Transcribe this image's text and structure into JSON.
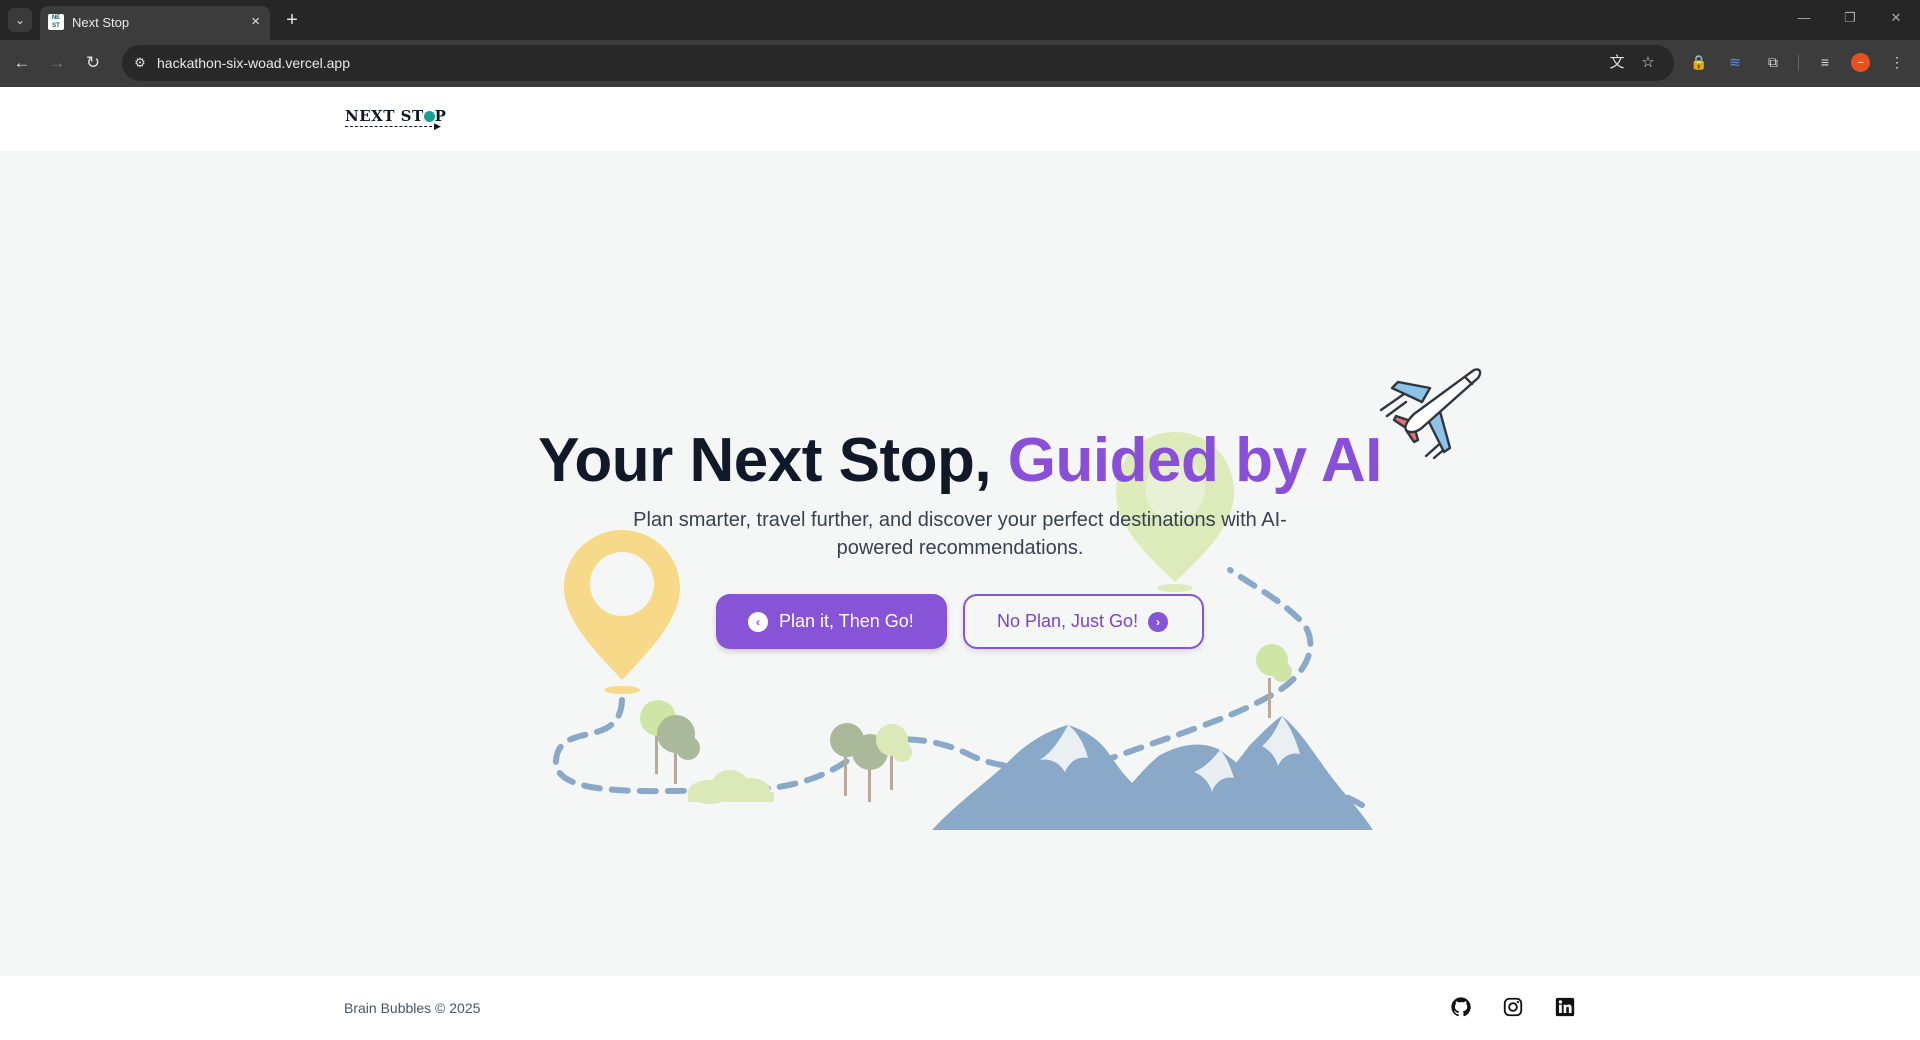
{
  "browser": {
    "tab_title": "Next Stop",
    "url": "hackathon-six-woad.vercel.app",
    "new_tab_glyph": "+",
    "close_glyph": "×"
  },
  "header": {
    "logo_text_pre": "NEXT ST",
    "logo_text_post": "P"
  },
  "hero": {
    "headline_main": "Your Next Stop, ",
    "headline_accent": "Guided by AI",
    "subline": "Plan smarter, travel further, and discover your perfect destinations with AI-powered recommendations.",
    "primary_button": "Plan it, Then Go!",
    "secondary_button": "No Plan, Just Go!"
  },
  "footer": {
    "copyright": "Brain Bubbles © 2025",
    "social": [
      "github-icon",
      "instagram-icon",
      "linkedin-icon"
    ]
  },
  "colors": {
    "accent": "#8754d8",
    "headline": "#111827",
    "path": "#8aa9c9",
    "pin_yellow": "#f7d98a",
    "pin_green": "#d9eab0"
  }
}
